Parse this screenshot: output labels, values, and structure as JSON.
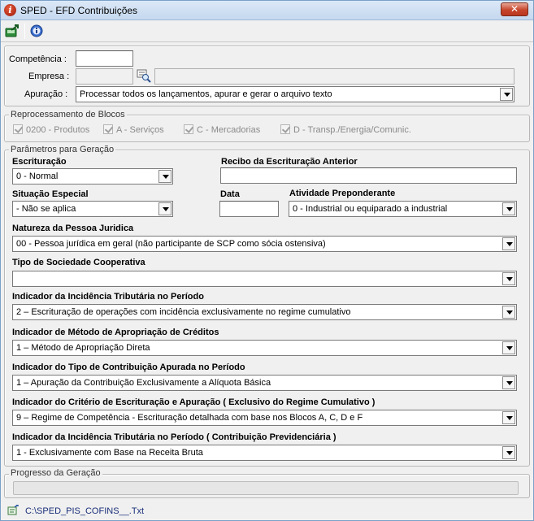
{
  "window": {
    "title": "SPED - EFD Contribuições",
    "close_label": "✕",
    "app_icon_glyph": "i"
  },
  "toolbar": {
    "items": [
      {
        "icon": "save-exit-icon"
      },
      {
        "icon": "help-icon"
      }
    ]
  },
  "header_panel": {
    "competencia_label": "Competência :",
    "competencia_value": "",
    "empresa_label": "Empresa :",
    "empresa_value": "",
    "apuracao_label": "Apuração :",
    "apuracao_value": "Processar todos os lançamentos, apurar e gerar o arquivo texto"
  },
  "reprocessamento": {
    "title": "Reprocessamento de Blocos",
    "items": [
      {
        "label": "0200 - Produtos",
        "checked": true
      },
      {
        "label": "A - Serviços",
        "checked": true
      },
      {
        "label": "C - Mercadorias",
        "checked": true
      },
      {
        "label": "D - Transp./Energia/Comunic.",
        "checked": true
      }
    ]
  },
  "parametros": {
    "title": "Parâmetros para Geração",
    "escrituracao_label": "Escrituração",
    "escrituracao_value": "0 - Normal",
    "recibo_label": "Recibo da Escrituração Anterior",
    "recibo_value": "",
    "situacao_label": "Situação Especial",
    "situacao_value": "- Não se aplica",
    "data_label": "Data",
    "data_value": "",
    "atividade_label": "Atividade Preponderante",
    "atividade_value": "0 - Industrial ou equiparado a industrial",
    "natureza_label": "Natureza da Pessoa Juridica",
    "natureza_value": "00 - Pessoa jurídica em geral (não participante de SCP como sócia ostensiva)",
    "cooperativa_label": "Tipo de Sociedade Cooperativa",
    "cooperativa_value": "",
    "incidencia_label": "Indicador da Incidência Tributária no Período",
    "incidencia_value": "2 – Escrituração de operações com incidência exclusivamente no regime cumulativo",
    "metodo_label": "Indicador de Método de Apropriação de Créditos",
    "metodo_value": "1 – Método de Apropriação Direta",
    "tipo_contrib_label": "Indicador do Tipo de Contribuição Apurada no Período",
    "tipo_contrib_value": "1 – Apuração da Contribuição Exclusivamente a Alíquota Básica",
    "criterio_label": "Indicador do Critério de Escrituração e Apuração ( Exclusivo do Regime Cumulativo )",
    "criterio_value": "9 – Regime de Competência - Escrituração detalhada com base nos Blocos A, C, D e F",
    "previdenciaria_label": "Indicador da Incidência Tributária no Período ( Contribuição Previdenciária )",
    "previdenciaria_value": "1 - Exclusivamente com Base na Receita Bruta"
  },
  "progresso": {
    "title": "Progresso da Geração",
    "value": 0
  },
  "status": {
    "path": "C:\\SPED_PIS_COFINS__.Txt"
  }
}
